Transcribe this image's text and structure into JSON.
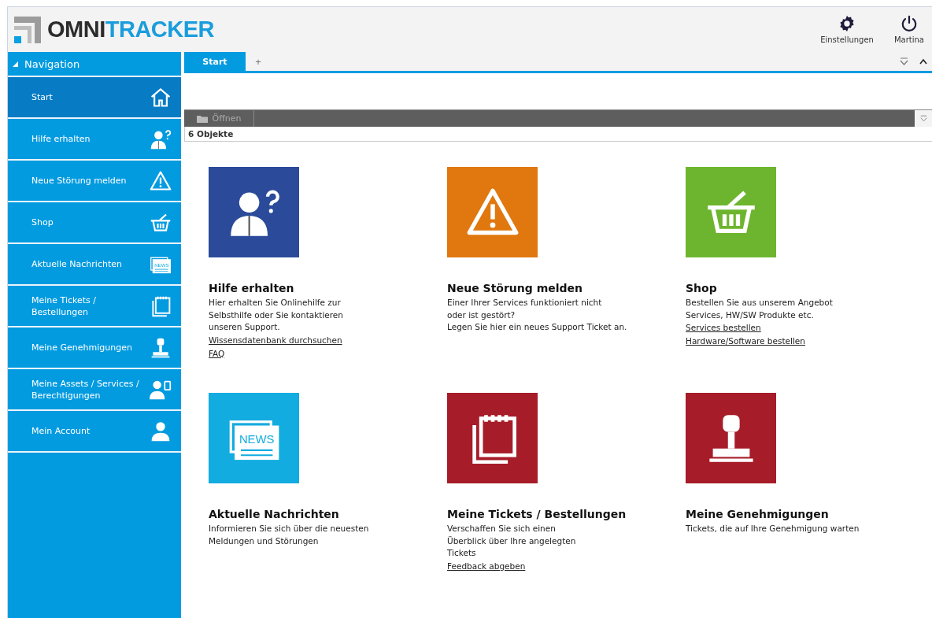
{
  "logo": {
    "part_1": "OMNI",
    "part_2": "TRACKER"
  },
  "header_actions": [
    {
      "kind": "settings",
      "label": "Einstellungen"
    },
    {
      "kind": "power",
      "label": "Martina"
    }
  ],
  "navigation": {
    "title": "Navigation",
    "expanded": true,
    "items": [
      {
        "kind": "home",
        "label": "Start",
        "selected": true
      },
      {
        "kind": "help",
        "label": "Hilfe erhalten",
        "selected": false
      },
      {
        "kind": "warning",
        "label": "Neue Störung melden",
        "selected": false
      },
      {
        "kind": "basket",
        "label": "Shop",
        "selected": false
      },
      {
        "kind": "news",
        "label": "Aktuelle Nachrichten",
        "selected": false,
        "icon_text": "NEWS"
      },
      {
        "kind": "notepad",
        "label": "Meine Tickets / Bestellungen",
        "selected": false
      },
      {
        "kind": "stamp",
        "label": "Meine Genehmigungen",
        "selected": false
      },
      {
        "kind": "assets",
        "label": "Meine Assets / Services / Berechtigungen",
        "selected": false
      },
      {
        "kind": "person",
        "label": "Mein Account",
        "selected": false
      }
    ]
  },
  "tabs": [
    {
      "label": "Start",
      "selected": true
    }
  ],
  "add_tab": "+",
  "toolbar": {
    "open_button": "Öffnen"
  },
  "count": "6 Objekte",
  "tiles": [
    {
      "kind": "help",
      "color": "#2b4a9a",
      "title": "Hilfe erhalten",
      "description": [
        "Hier erhalten Sie Onlinehilfe zur",
        "Selbsthilfe oder Sie kontaktieren",
        "unseren Support."
      ],
      "links": [
        "Wissensdatenbank durchsuchen",
        "FAQ"
      ]
    },
    {
      "kind": "warning",
      "color": "#e0780f",
      "title": "Neue Störung melden",
      "description": [
        "Einer Ihrer Services funktioniert nicht",
        "oder ist gestört?",
        "Legen Sie hier ein neues Support Ticket an."
      ]
    },
    {
      "kind": "basket",
      "color": "#6db52e",
      "title": "Shop",
      "description": [
        "Bestellen Sie aus unserem Angebot",
        "Services, HW/SW Produkte etc."
      ],
      "links": [
        "Services bestellen",
        "Hardware/Software bestellen"
      ]
    },
    {
      "kind": "news",
      "color": "#13ace0",
      "icon_text": "NEWS",
      "title": "Aktuelle Nachrichten",
      "description": [
        "Informieren Sie sich über die neuesten",
        "Meldungen und Störungen"
      ]
    },
    {
      "kind": "notepad",
      "color": "#a61c28",
      "title": "Meine Tickets / Bestellungen",
      "description": [
        "Verschaffen Sie sich einen",
        "Überblick über Ihre angelegten",
        "Tickets"
      ],
      "links": [
        "Feedback abgeben"
      ]
    },
    {
      "kind": "stamp",
      "color": "#a61c28",
      "title": "Meine Genehmigungen",
      "description": [
        "Tickets, die auf Ihre Genehmigung warten"
      ]
    }
  ]
}
